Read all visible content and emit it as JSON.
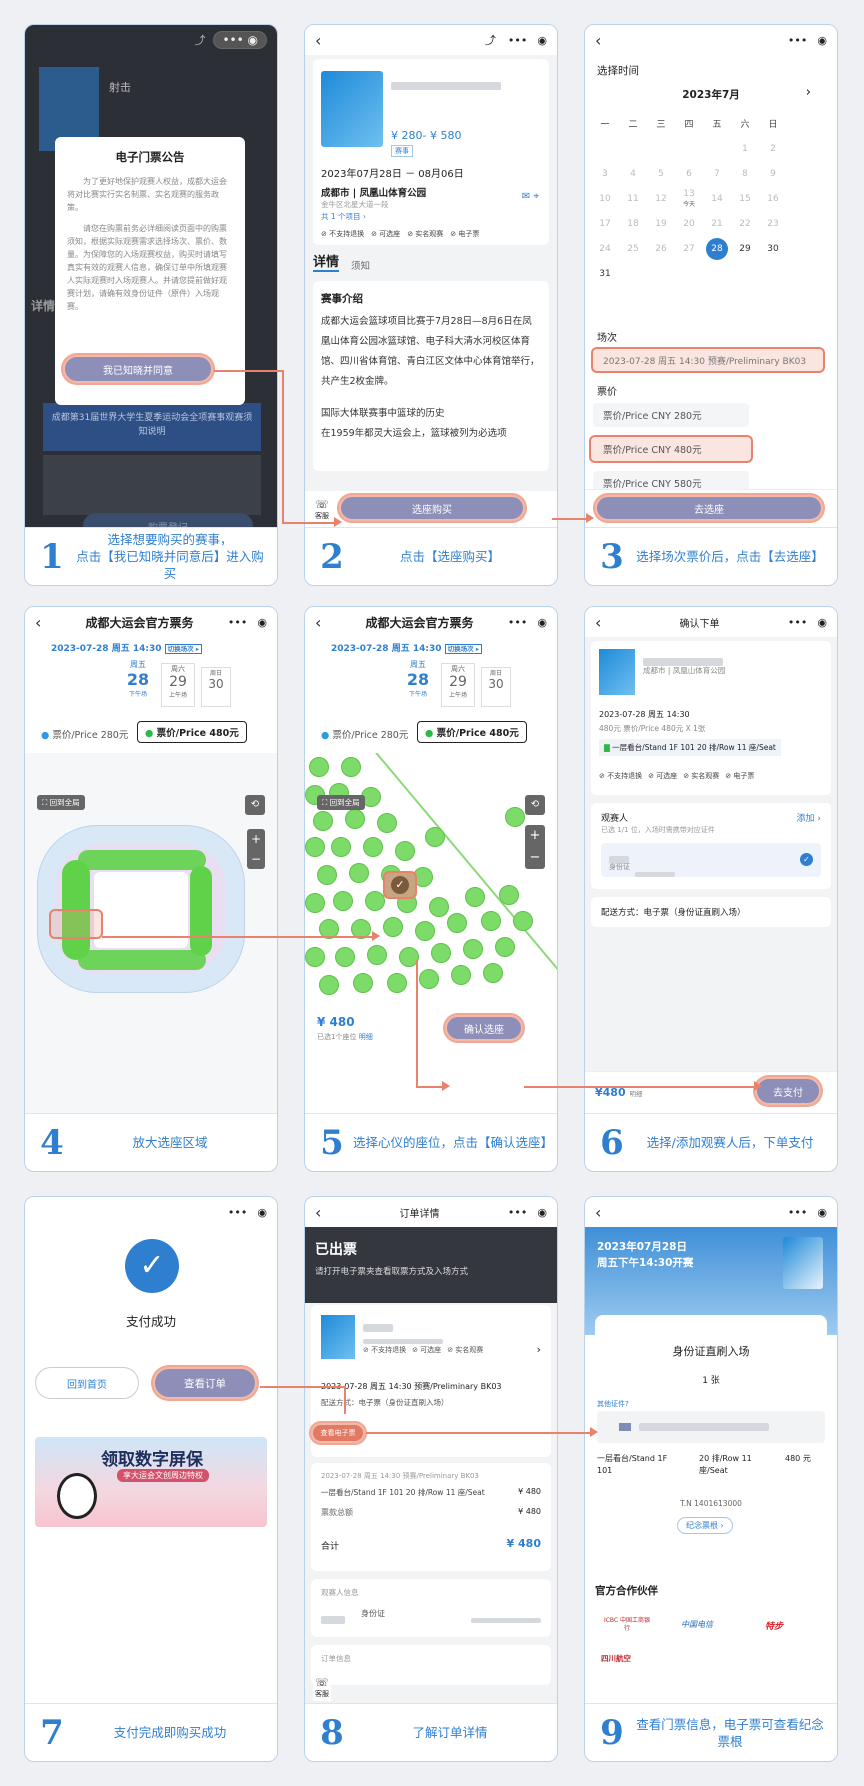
{
  "steps": [
    {
      "num": "1",
      "caption": "选择想要购买的赛事，\n点击【我已知晓并同意后】进入购买"
    },
    {
      "num": "2",
      "caption": "点击【选座购买】"
    },
    {
      "num": "3",
      "caption": "选择场次票价后，点击【去选座】"
    },
    {
      "num": "4",
      "caption": "放大选座区域"
    },
    {
      "num": "5",
      "caption": "选择心仪的座位，点击【确认选座】"
    },
    {
      "num": "6",
      "caption": "选择/添加观赛人后，下单支付"
    },
    {
      "num": "7",
      "caption": "支付完成即购买成功"
    },
    {
      "num": "8",
      "caption": "了解订单详情"
    },
    {
      "num": "9",
      "caption": "查看门票信息，电子票可查看纪念票根"
    }
  ],
  "s1": {
    "event": "射击",
    "modal_title": "电子门票公告",
    "p1": "为了更好地保护观赛人权益，成都大运会将对比赛实行实名制票、实名观赛的服务政策。",
    "p2": "请您在购票前务必详细阅读页面中的购票须知，根据实际观赛需求选择场次、票价、数量。为保障您的入场观赛权益，购买时请填写真实有效的观赛人信息，确保订单中所填观赛人实际观赛时入场观赛人。并请您提前做好观赛计划，请确有效身份证件（原件）入场观赛。",
    "agree": "我已知晓并同意",
    "detail": "详情",
    "bg_notice": "成都第31届世界大学生夏季运动会全项赛事观赛须知说明",
    "ticket": "购票登记"
  },
  "s2": {
    "price": "¥ 280- ¥ 580",
    "tag": "赛事",
    "dates": "2023年07月28日 － 08月06日",
    "venue": "成都市 | 凤凰山体育公园",
    "addr": "金牛区北星大道一段",
    "projects": "共 1 个项目 ›",
    "tags": [
      "不支持退换",
      "可选座",
      "实名观赛",
      "电子票"
    ],
    "tab_detail": "详情",
    "tab_notice": "须知",
    "intro_title": "赛事介绍",
    "intro": "成都大运会篮球项目比赛于7月28日—8月6日在凤凰山体育公园冰篮球馆、电子科大清水河校区体育馆、四川省体育馆、青白江区文体中心体育馆举行，共产生2枚金牌。",
    "hist": "国际大体联赛事中篮球的历史",
    "hist2": "在1959年都灵大运会上，篮球被列为必选项",
    "kefu": "客服",
    "buy": "选座购买"
  },
  "s3": {
    "title": "选择时间",
    "month": "2023年7月",
    "weekdays": [
      "一",
      "二",
      "三",
      "四",
      "五",
      "六",
      "日"
    ],
    "today": "今天",
    "session_label": "场次",
    "session": "2023-07-28 周五 14:30 预赛/Preliminary BK03",
    "price_label": "票价",
    "prices": [
      "票价/Price CNY 280元",
      "票价/Price CNY 480元",
      "票价/Price CNY 580元"
    ],
    "go": "去选座"
  },
  "s4": {
    "title": "成都大运会官方票务",
    "date": "2023-07-28 周五 14:30",
    "switch": "切换场次 ▸",
    "days": [
      {
        "w": "周五",
        "d": "28",
        "s": "下午场"
      },
      {
        "w": "周六",
        "d": "29",
        "s": "上午场"
      },
      {
        "w": "周日",
        "d": "30",
        "s": ""
      }
    ],
    "p1": "票价/Price 280元",
    "p2": "票价/Price 480元",
    "overview": "回到全局"
  },
  "s5": {
    "title": "成都大运会官方票务",
    "date": "2023-07-28 周五 14:30",
    "switch": "切换场次 ▸",
    "p1": "票价/Price 280元",
    "p2": "票价/Price 480元",
    "overview": "回到全局",
    "price": "¥ 480",
    "selected": "已选1个座位",
    "detail": "明细",
    "confirm": "确认选座"
  },
  "s6": {
    "title": "确认下单",
    "venue": "成都市 | 凤凰山体育公园",
    "session": "2023-07-28 周五 14:30",
    "price_line": "480元 票价/Price 480元 X 1张",
    "seat": "一层看台/Stand 1F 101 20 排/Row 11 座/Seat",
    "tags": [
      "不支持退换",
      "可选座",
      "实名观赛",
      "电子票"
    ],
    "viewer": "观赛人",
    "add": "添加 ›",
    "viewer_sub": "已选 1/1 位，入场时需携带对应证件",
    "id": "身份证",
    "delivery": "配送方式：电子票（身份证直刷入场）",
    "total": "¥480",
    "mx": "明细",
    "pay": "去支付"
  },
  "s7": {
    "success": "支付成功",
    "home": "回到首页",
    "order": "查看订单",
    "banner": "领取数字屏保",
    "banner_sub": "享大运会文创周边特权"
  },
  "s8": {
    "title": "订单详情",
    "status": "已出票",
    "status_sub": "请打开电子票夹查看取票方式及入场方式",
    "tags": [
      "不支持退换",
      "可选座",
      "实名观赛"
    ],
    "session": "2023-07-28 周五 14:30 预赛/Preliminary BK03",
    "delivery": "配送方式：电子票（身份证直刷入场）",
    "eticket": "查看电子票",
    "line1": "2023-07-28 周五 14:30 预赛/Preliminary BK03",
    "seat": "一层看台/Stand 1F 101 20 排/Row 11 座/Seat",
    "seat_price": "¥ 480",
    "sum_label": "票款总额",
    "sum": "¥ 480",
    "total_label": "合计",
    "total": "¥ 480",
    "viewer_info": "观赛人信息",
    "id": "身份证",
    "order_info": "订单信息",
    "kefu": "客服"
  },
  "s9": {
    "date": "2023年07月28日",
    "time": "周五下午14:30开赛",
    "entry": "身份证直刷入场",
    "count": "1 张",
    "other": "其他证件?",
    "seat_a": "一层看台/Stand 1F 101",
    "seat_b": "20 排/Row 11 座/Seat",
    "seat_c": "480 元",
    "tn": "T.N 1401613000",
    "stub": "纪念票根 ›",
    "partners": "官方合作伙伴",
    "p1": "ICBC 中国工商银行",
    "p2": "中国电信",
    "p3": "特步",
    "p4": "四川航空"
  }
}
